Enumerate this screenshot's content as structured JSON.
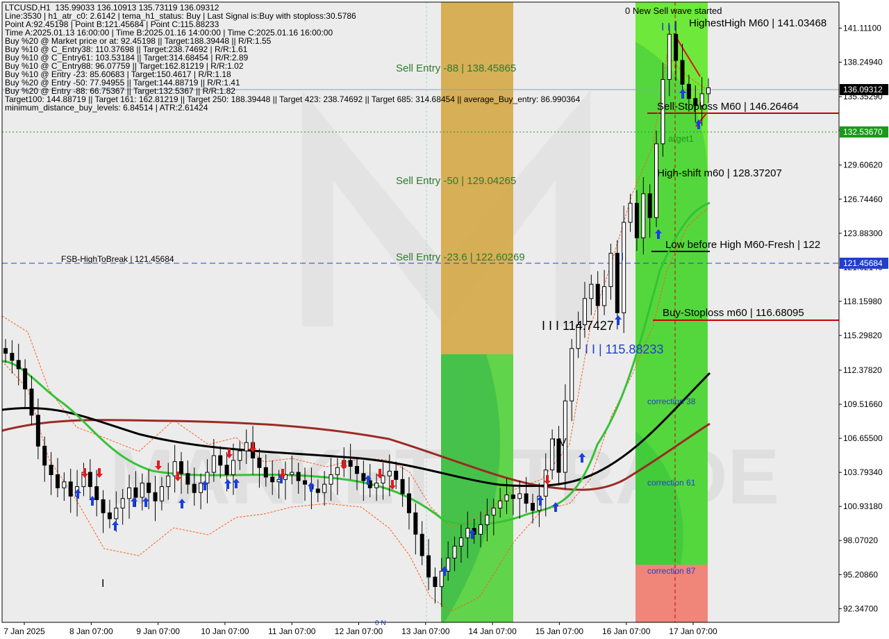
{
  "colors": {
    "background": "#ffffff",
    "plot_bg": "#ececec",
    "zone_orange": "#d4a53c",
    "zone_green": "#46c24a",
    "zone_lime": "#6ee83a",
    "zone_red": "#f0857a",
    "bull_candle": "#000000",
    "bear_candle": "#000000",
    "ma_black": "#000000",
    "ma_darkred": "#9b2a24",
    "ma_green": "#36c236",
    "band_orange": "#ff5a1e",
    "level_red": "#c80000",
    "level_blue": "#1f3fcc",
    "level_green": "#1a9a1a",
    "buy_arrow": "#1a3fdc",
    "sell_arrow": "#e21b1b"
  },
  "info_lines": [
    "LTCUSD,H1  135.99033 136.10913 135.73119 136.09312",
    "Line:3530 | h1_atr_c0: 2.6142 | tema_h1_status: Buy | Last Signal is:Buy with stoploss:30.5786",
    "Point A:92.45198 | Point B:121.45684 | Point C:115.88233",
    "Time A:2025.01.13 16:00:00 | Time B:2025.01.16 14:00:00 | Time C:2025.01.16 16:00:00",
    "Buy %20 @ Market price or at: 92.45198 || Target:188.39448 || R/R:1.55",
    "Buy %10 @ C_Entry38: 110.37698 || Target:238.74692 | R/R:1.61",
    "Buy %10 @ C_Entry61: 103.53184 || Target:314.68454 | R/R:2.89",
    "Buy %10 @ C_Entry88: 96.07759 || Target:162.81219 | R/R:1.02",
    "Buy %10 @ Entry -23: 85.60683 | Target:150.4617 | R/R:1.18",
    "Buy %20 @ Entry -50: 77.94955 || Target:144.88719 || R/R:1.41",
    "Buy %20 @ Entry -88: 66.75367 || Target:132.5367 || R/R:1.82",
    "Target100: 144.88719 || Target 161: 162.81219 || Target 250: 188.39448 || Target 423: 238.74692 || Target 685: 314.68454 || average_Buy_entry: 86.990364",
    "minimum_distance_buy_levels: 6.84514 | ATR:2.61424"
  ],
  "annotations": {
    "wave_status": "0 New Sell wave started",
    "highest_high": "HighestHigh    M60 | 141.03468",
    "sell_stoploss": "Sell-Stoploss M60 | 146.26464",
    "target1": "arget1",
    "high_shift": "High-shift m60 | 128.37207",
    "low_before_high": "Low before High    M60-Fresh | 122",
    "buy_stoploss": "Buy-Stoploss m60 | 116.68095",
    "sell_entry_88": "Sell Entry -88 | 138.45865",
    "sell_entry_50": "Sell Entry -50 | 129.04265",
    "sell_entry_23": "Sell Entry -23.6 | 122.60269",
    "fsb": "FSB-HighToBreak | 121.45684",
    "label_iii_top": "I I I",
    "label_iii_114": "I I I 114.7427",
    "label_ii_115": "I I | 115.88233",
    "label_i_mid": "I",
    "label_iv": "I V",
    "label_i_low": "I",
    "label_bottom_small": "0 N",
    "corr_38": "correction 38",
    "corr_61": "correction 61",
    "corr_87": "correction 87",
    "watermark": "MARKETZITRADE"
  },
  "price_tags": {
    "current": "136.09312",
    "green_level": "132.53670",
    "blue_level": "121.45684"
  },
  "chart_data": {
    "type": "candlestick",
    "symbol": "LTCUSD",
    "timeframe": "H1",
    "ylim": [
      91.2,
      143.3
    ],
    "y_ticks": [
      "141.11100",
      "138.24940",
      "135.35290",
      "132.53670",
      "129.60620",
      "126.74460",
      "123.88300",
      "121.02140",
      "118.15980",
      "115.29820",
      "112.37820",
      "109.51660",
      "106.65500",
      "103.79340",
      "100.93180",
      "98.07020",
      "95.20860",
      "92.34700"
    ],
    "x_ticks": [
      "7 Jan 2025",
      "8 Jan 07:00",
      "9 Jan 07:00",
      "10 Jan 07:00",
      "11 Jan 07:00",
      "12 Jan 07:00",
      "13 Jan 07:00",
      "14 Jan 07:00",
      "15 Jan 07:00",
      "16 Jan 07:00",
      "17 Jan 07:00"
    ],
    "levels": [
      {
        "name": "current_price",
        "value": 136.09312
      },
      {
        "name": "green_dotted",
        "value": 132.5367
      },
      {
        "name": "fsb_high_to_break",
        "value": 121.45684
      },
      {
        "name": "sell_stoploss",
        "value": 134.1
      },
      {
        "name": "low_before_high",
        "value": 122.6
      },
      {
        "name": "buy_stoploss",
        "value": 116.68
      }
    ],
    "close_series": [
      113.8,
      113.2,
      112.5,
      110.8,
      108.6,
      106.0,
      104.4,
      103.6,
      102.5,
      103.0,
      101.8,
      102.6,
      103.8,
      102.6,
      101.5,
      100.4,
      99.9,
      100.8,
      101.6,
      102.5,
      101.7,
      102.9,
      102.1,
      101.4,
      102.6,
      103.5,
      104.7,
      103.7,
      102.8,
      102.1,
      102.9,
      103.8,
      105.2,
      104.4,
      103.6,
      104.8,
      105.6,
      106.3,
      105.0,
      104.2,
      103.4,
      103.0,
      103.2,
      103.6,
      103.8,
      103.1,
      102.8,
      102.4,
      102.1,
      102.8,
      103.6,
      104.2,
      104.8,
      104.3,
      103.7,
      103.1,
      102.5,
      102.9,
      103.5,
      103.9,
      103.2,
      102.0,
      100.4,
      98.6,
      96.8,
      95.0,
      94.2,
      95.5,
      96.6,
      97.6,
      98.3,
      99.1,
      98.6,
      99.4,
      100.2,
      100.8,
      101.4,
      101.9,
      101.6,
      102.0,
      101.2,
      100.6,
      101.8,
      104.0,
      106.6,
      103.8,
      109.8,
      114.2,
      116.2,
      118.4,
      119.6,
      117.8,
      119.4,
      122.2,
      117.2,
      124.8,
      126.4,
      123.5,
      127.2,
      125.2,
      131.4,
      136.8,
      140.6,
      138.4,
      136.4,
      135.2,
      134.6,
      135.6,
      136.1
    ]
  }
}
